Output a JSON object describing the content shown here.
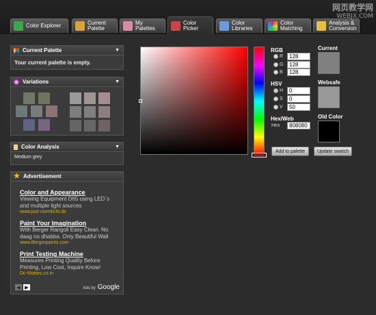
{
  "tabs": [
    {
      "label": "Color Explorer",
      "icon": "color-explorer-icon",
      "color": "#3aa84a"
    },
    {
      "label": "Current\nPalette",
      "icon": "palette-icon",
      "color": "#d9a43a"
    },
    {
      "label": "My\nPalettes",
      "icon": "my-palettes-icon",
      "color": "#d98aa8"
    },
    {
      "label": "Color\nPicker",
      "icon": "color-picker-icon",
      "color": "#c44"
    },
    {
      "label": "Color\nLibraries",
      "icon": "color-libraries-icon",
      "color": "#6a9adf"
    },
    {
      "label": "Color\nMatching",
      "icon": "color-matching-icon",
      "color": "#e25"
    },
    {
      "label": "Analysis &\nConversion",
      "icon": "analysis-icon",
      "color": "#e8c13a"
    }
  ],
  "watermark": {
    "line1": "网页教学网",
    "line2": "WEBJX.COM"
  },
  "current_palette": {
    "title": "Current Palette",
    "text": "Your current palette is empty."
  },
  "variations": {
    "title": "Variations",
    "left_colors": [
      "#6d7966",
      "#6f745d",
      "#6b7a78",
      "#7b7b7b",
      "#8a7275",
      "#5e6481",
      "#77677e"
    ],
    "right_colors": [
      "#9a9a9a",
      "#a09595",
      "#a58e93",
      "#7d7d7d",
      "#7f7f7f",
      "#8d7e80",
      "#656565",
      "#676767",
      "#6d6363"
    ]
  },
  "color_analysis": {
    "title": "Color Analysis",
    "text": "Medium grey"
  },
  "advertisement": {
    "title": "Advertisement",
    "ads": [
      {
        "title": "Color and Appearance",
        "desc": "Viewing Equipment D65 using LED`s and multiple light sources",
        "url": "www.just-normlicht.de"
      },
      {
        "title": "Paint Your Imagination",
        "desc": "With Berger Rangoli Easy Clean. No daag no dhabba. Only Beautiful Wall",
        "url": "www.Bergerpaints.com"
      },
      {
        "title": "Print Testing Machine",
        "desc": "Measures Printing Quality Before Printing, Low Cost, Inquire Know!",
        "url": "Dc-Motors.co.in"
      }
    ],
    "ads_by": "Ads by",
    "brand": "Google"
  },
  "picker": {
    "rgb_label": "RGB",
    "r_label": "R",
    "r": "128",
    "g_label": "G",
    "g": "128",
    "b_label": "B",
    "b": "128",
    "hsv_label": "HSV",
    "h_label": "H",
    "h": "0",
    "s_label": "S",
    "s": "0",
    "v_label": "V",
    "v": "50",
    "hex_label": "Hex/Web",
    "hex_sub": "Hex",
    "hex": "808080",
    "add_button": "Add to palette",
    "update_button": "Update swatch",
    "current_label": "Current",
    "current_color": "#808080",
    "websafe_label": "Websafe",
    "websafe_color": "#999999",
    "old_label": "Old Color",
    "old_color": "#000000"
  }
}
